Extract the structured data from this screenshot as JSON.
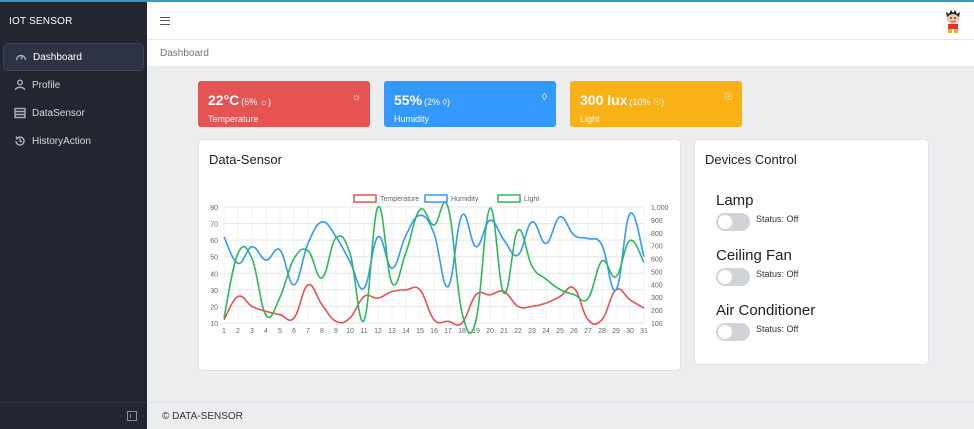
{
  "sidebar": {
    "brand": "IOT SENSOR",
    "items": [
      {
        "label": "Dashboard",
        "icon": "speedometer-icon"
      },
      {
        "label": "Profile",
        "icon": "user-icon"
      },
      {
        "label": "DataSensor",
        "icon": "list-icon"
      },
      {
        "label": "HistoryAction",
        "icon": "history-icon"
      }
    ]
  },
  "breadcrumb": "Dashboard",
  "stats": {
    "temperature": {
      "value": "22°C",
      "pct": "(5% ☼)",
      "label": "Temperature",
      "icon": "☼",
      "color": "#e55353"
    },
    "humidity": {
      "value": "55%",
      "pct": "(2% ◊)",
      "label": "Humidity",
      "icon": "◊",
      "color": "#3399ff"
    },
    "light": {
      "value": "300 lux",
      "pct": "(10% ☉)",
      "label": "Light",
      "icon": "☉",
      "color": "#f9b115"
    }
  },
  "chart_title": "Data-Sensor",
  "chart_data": {
    "type": "line",
    "categories": [
      "1",
      "2",
      "3",
      "4",
      "5",
      "6",
      "7",
      "8",
      "9",
      "10",
      "11",
      "12",
      "13",
      "14",
      "15",
      "16",
      "17",
      "18",
      "19",
      "20",
      "21",
      "22",
      "23",
      "24",
      "25",
      "26",
      "27",
      "28",
      "29",
      "30",
      "31"
    ],
    "series": [
      {
        "name": "Temperature",
        "axis": "left",
        "color": "#e55353",
        "values": [
          12,
          26,
          20,
          17,
          15,
          13,
          33,
          21,
          11,
          13,
          26,
          25,
          29,
          30,
          30,
          12,
          11,
          10,
          27,
          27,
          29,
          20,
          20,
          22,
          26,
          31,
          12,
          12,
          30,
          24,
          19
        ]
      },
      {
        "name": "Humidity",
        "axis": "left",
        "color": "#3399ff",
        "values": [
          62,
          46,
          56,
          48,
          54,
          33,
          58,
          71,
          62,
          47,
          31,
          62,
          43,
          63,
          75,
          64,
          32,
          75,
          56,
          72,
          60,
          51,
          71,
          58,
          74,
          63,
          61,
          57,
          30,
          76,
          50
        ]
      },
      {
        "name": "Light",
        "axis": "right",
        "color": "#2eb85c",
        "values": [
          140,
          640,
          600,
          160,
          300,
          600,
          660,
          450,
          760,
          640,
          120,
          1000,
          410,
          650,
          980,
          860,
          1000,
          180,
          120,
          990,
          330,
          820,
          540,
          440,
          360,
          320,
          290,
          580,
          460,
          740,
          570
        ]
      }
    ],
    "y_left": {
      "min": 10,
      "max": 80,
      "ticks": [
        "10",
        "20",
        "30",
        "40",
        "50",
        "60",
        "70",
        "80"
      ]
    },
    "y_right": {
      "min": 100,
      "max": 1000,
      "ticks": [
        "100",
        "200",
        "300",
        "400",
        "500",
        "600",
        "700",
        "800",
        "900",
        "1,000"
      ]
    },
    "legend": "top-center",
    "grid": true
  },
  "devices": {
    "title": "Devices Control",
    "items": [
      {
        "name": "Lamp",
        "status": "Status: Off"
      },
      {
        "name": "Ceiling Fan",
        "status": "Status: Off"
      },
      {
        "name": "Air Conditioner",
        "status": "Status: Off"
      }
    ]
  },
  "footer": "© DATA-SENSOR"
}
